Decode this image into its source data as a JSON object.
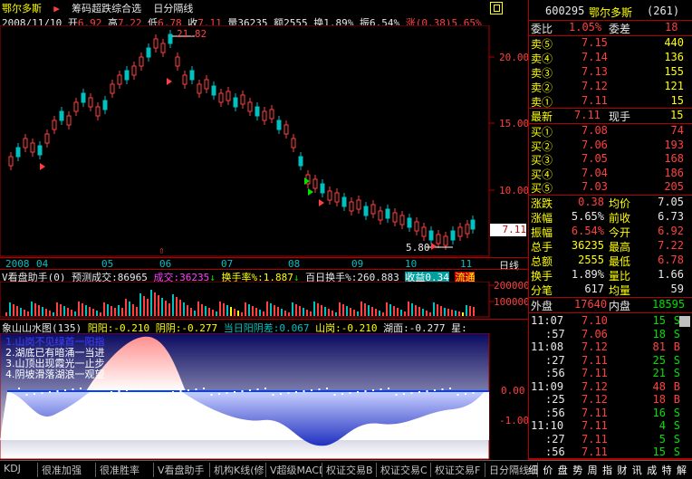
{
  "header": {
    "stock_name": "鄂尔多斯",
    "indicator_title": "筹码超跌综合选",
    "period": "日分隔线",
    "date": "2008/11/10",
    "open_label": "开",
    "open": "6.92",
    "high_label": "高",
    "high": "7.22",
    "low_label": "低",
    "low": "6.78",
    "close_label": "收",
    "close": "7.11",
    "volume_label": "量",
    "volume": "36235",
    "amount_label": "额",
    "amount": "2555",
    "turnover_label": "换",
    "turnover": "1.89%",
    "amplitude_label": "振",
    "amplitude": "6.54%",
    "change_label": "涨",
    "change": "(0.38)",
    "change_pct": "5.65%"
  },
  "kline": {
    "price_ticks": [
      "20.00",
      "15.00",
      "10.00"
    ],
    "high_marker": "21.82",
    "low_marker": "5.80",
    "last_price_tag": "7.11",
    "months": [
      "2008",
      "04",
      "05",
      "06",
      "07",
      "08",
      "09",
      "10",
      "11"
    ],
    "axis_unit": "日线"
  },
  "volume_panel": {
    "title": "V看盘助手(0)",
    "forecast_label": "预测成交:",
    "forecast_value": "86965",
    "vol_label": "成交:",
    "vol_value": "36235",
    "turnover_rate_label": "换手率%:",
    "turnover_rate_value": "1.887",
    "hundred_day_label": "百日换手%:",
    "hundred_day_value": "260.883",
    "profit_label": "收益",
    "profit_value": "0.34",
    "flow_label": "流通",
    "ticks": [
      "200000",
      "100000"
    ]
  },
  "indicator_panel": {
    "title": "象山山水图(135)",
    "yang_label": "阳阳:",
    "yang_value": "-0.210",
    "yin_label": "阴阴:",
    "yin_value": "-0.277",
    "diff_label": "当日阳阴差:",
    "diff_value": "0.067",
    "shanling_label": "山岗:",
    "shanling_value": "-0.210",
    "hump_label": "湖面:",
    "hump_value": "-0.277",
    "star_label": "星:",
    "legend": [
      "1.山岗不见绿首一阳指",
      "2.湖底已有暗涌一当进",
      "3.山顶出现霞光一止步",
      "4.阴坡滑落湖浪一观望"
    ],
    "ticks": [
      "0.00",
      "-1.00"
    ]
  },
  "quote": {
    "code": "600295",
    "name": "鄂尔多斯",
    "num": "(261)",
    "weibi_label": "委比",
    "weibi_value": "1.05%",
    "weicha_label": "委差",
    "weicha_value": "18",
    "asks": [
      {
        "label": "卖⑤",
        "price": "7.15",
        "vol": "440"
      },
      {
        "label": "卖④",
        "price": "7.14",
        "vol": "136"
      },
      {
        "label": "卖③",
        "price": "7.13",
        "vol": "155"
      },
      {
        "label": "卖②",
        "price": "7.12",
        "vol": "121"
      },
      {
        "label": "卖①",
        "price": "7.11",
        "vol": "15"
      }
    ],
    "latest_label": "最新",
    "latest_value": "7.11",
    "current_vol_label": "现手",
    "current_vol_value": "15",
    "bids": [
      {
        "label": "买①",
        "price": "7.08",
        "vol": "74"
      },
      {
        "label": "买②",
        "price": "7.06",
        "vol": "193"
      },
      {
        "label": "买③",
        "price": "7.05",
        "vol": "168"
      },
      {
        "label": "买④",
        "price": "7.04",
        "vol": "186"
      },
      {
        "label": "买⑤",
        "price": "7.03",
        "vol": "205"
      }
    ],
    "stats": [
      {
        "l1": "涨跌",
        "v1": "0.38",
        "l2": "均价",
        "v2": "7.05"
      },
      {
        "l1": "涨幅",
        "v1": "5.65%",
        "l2": "前收",
        "v2": "6.73"
      },
      {
        "l1": "振幅",
        "v1": "6.54%",
        "l2": "今开",
        "v2": "6.92"
      },
      {
        "l1": "总手",
        "v1": "36235",
        "l2": "最高",
        "v2": "7.22"
      },
      {
        "l1": "总额",
        "v1": "2555",
        "l2": "最低",
        "v2": "6.78"
      },
      {
        "l1": "换手",
        "v1": "1.89%",
        "l2": "量比",
        "v2": "1.66"
      },
      {
        "l1": "分笔",
        "v1": "617",
        "l2": "均量",
        "v2": "59"
      }
    ],
    "outer_label": "外盘",
    "outer_value": "17640",
    "inner_label": "内盘",
    "inner_value": "18595",
    "ticks": [
      {
        "time": "11:07",
        "price": "7.10",
        "vol": "15",
        "bs": "S"
      },
      {
        "time": ":57",
        "price": "7.06",
        "vol": "18",
        "bs": "S"
      },
      {
        "time": "11:08",
        "price": "7.12",
        "vol": "81",
        "bs": "B"
      },
      {
        "time": ":27",
        "price": "7.11",
        "vol": "25",
        "bs": "S"
      },
      {
        "time": ":56",
        "price": "7.11",
        "vol": "21",
        "bs": "S"
      },
      {
        "time": "11:09",
        "price": "7.12",
        "vol": "48",
        "bs": "B"
      },
      {
        "time": ":25",
        "price": "7.12",
        "vol": "18",
        "bs": "B"
      },
      {
        "time": ":56",
        "price": "7.11",
        "vol": "16",
        "bs": "S"
      },
      {
        "time": "11:10",
        "price": "7.11",
        "vol": "4",
        "bs": "S"
      },
      {
        "time": ":27",
        "price": "7.11",
        "vol": "5",
        "bs": "S"
      },
      {
        "time": ":56",
        "price": "7.11",
        "vol": "15",
        "bs": "S"
      }
    ],
    "bottom_tabs": [
      "细",
      "价",
      "盘",
      "势",
      "周",
      "指",
      "财",
      "讯",
      "成",
      "特",
      "解"
    ]
  },
  "tabs": [
    "KDJ",
    "很准加强",
    "很准胜率",
    "V看盘助手",
    "机构K线(修",
    "V超级MACD",
    "权证交易B",
    "权证交易C",
    "权证交易F",
    "日分隔线"
  ],
  "colors": {
    "up": "#ff4040",
    "down": "#00c0c0",
    "border": "#b00000"
  }
}
